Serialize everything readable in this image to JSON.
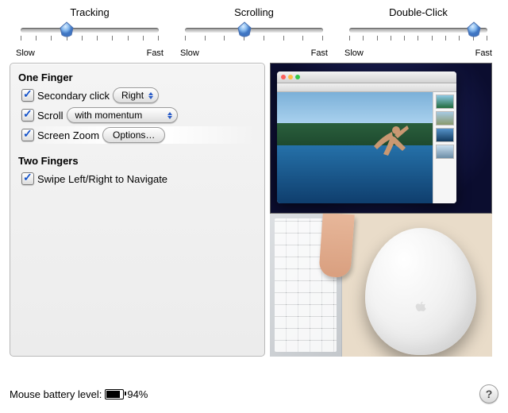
{
  "sliders": {
    "tracking": {
      "title": "Tracking",
      "low": "Slow",
      "high": "Fast",
      "ticks": 10,
      "value_index": 3
    },
    "scrolling": {
      "title": "Scrolling",
      "low": "Slow",
      "high": "Fast",
      "ticks": 8,
      "value_index": 3
    },
    "doubleclick": {
      "title": "Double-Click",
      "low": "Slow",
      "high": "Fast",
      "ticks": 11,
      "value_index": 9
    }
  },
  "sections": {
    "one_finger_heading": "One Finger",
    "two_fingers_heading": "Two Fingers"
  },
  "options": {
    "secondary_click": {
      "checked": true,
      "label": "Secondary click",
      "popup_value": "Right"
    },
    "scroll": {
      "checked": true,
      "label": "Scroll",
      "popup_value": "with momentum"
    },
    "screen_zoom": {
      "checked": true,
      "label": "Screen Zoom",
      "button_label": "Options…"
    },
    "swipe_navigate": {
      "checked": true,
      "label": "Swipe Left/Right to Navigate"
    }
  },
  "footer": {
    "battery_label": "Mouse battery level:",
    "battery_percent_text": "94%",
    "battery_fill_pct": 94,
    "help_symbol": "?"
  }
}
